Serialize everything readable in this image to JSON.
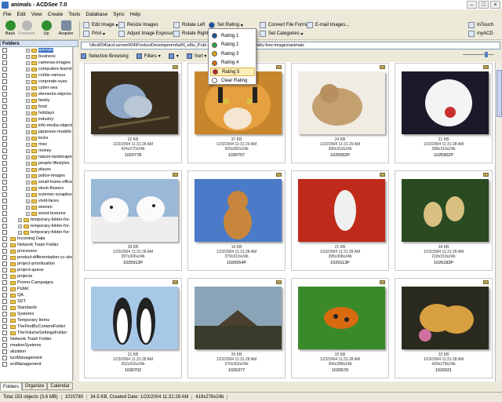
{
  "window": {
    "title": "animals - ACDSee 7.0"
  },
  "menu": [
    "File",
    "Edit",
    "View",
    "Create",
    "Tools",
    "Database",
    "Sync",
    "Help"
  ],
  "toolbar": {
    "back": "Back",
    "forward": "Forward",
    "up": "Up",
    "acquire": "Acquire",
    "edit_image": "Edit Image",
    "print": "Print",
    "resize": "Resize Images",
    "adjust": "Adjust Image Exposure",
    "rotate_left": "Rotate Left",
    "rotate_right": "Rotate Right",
    "set_rating": "Set Rating",
    "convert": "Convert File Format",
    "set_categories": "Set Categories",
    "email": "E-mail Images...",
    "intouch": "InTouch",
    "myacd": "myACD"
  },
  "rating_menu": {
    "items": [
      "Rating 1",
      "Rating 2",
      "Rating 3",
      "Rating 4",
      "Rating 5"
    ],
    "clear": "Clear Rating",
    "selected_index": 4,
    "colors": [
      "#1d4fa0",
      "#2e9e3e",
      "#e0a010",
      "#d86a10",
      "#c02020"
    ]
  },
  "folders": {
    "header": "Folders",
    "items": [
      {
        "label": "animals",
        "depth": 2,
        "exp": "+"
      },
      {
        "label": "business",
        "depth": 2,
        "exp": "+"
      },
      {
        "label": "cameras-images",
        "depth": 2,
        "exp": "+"
      },
      {
        "label": "computers-learning",
        "depth": 2,
        "exp": "+"
      },
      {
        "label": "corbis-various",
        "depth": 2,
        "exp": "+"
      },
      {
        "label": "corporate-eyes",
        "depth": 2,
        "exp": "+"
      },
      {
        "label": "cyber-sea",
        "depth": 2,
        "exp": "+"
      },
      {
        "label": "elements-objects-",
        "depth": 2,
        "exp": "+"
      },
      {
        "label": "family",
        "depth": 2,
        "exp": "+"
      },
      {
        "label": "food",
        "depth": 2,
        "exp": "+"
      },
      {
        "label": "holidays",
        "depth": 2,
        "exp": "+"
      },
      {
        "label": "industry",
        "depth": 2,
        "exp": "+"
      },
      {
        "label": "info-media-objects",
        "depth": 2,
        "exp": "+"
      },
      {
        "label": "japanese-models",
        "depth": 2,
        "exp": "+"
      },
      {
        "label": "locks",
        "depth": 2,
        "exp": "+"
      },
      {
        "label": "misc",
        "depth": 2,
        "exp": "+"
      },
      {
        "label": "money",
        "depth": 2,
        "exp": "+"
      },
      {
        "label": "nature-landscapes",
        "depth": 2,
        "exp": "+"
      },
      {
        "label": "people-lifestyles",
        "depth": 2,
        "exp": "+"
      },
      {
        "label": "places",
        "depth": 2,
        "exp": "+"
      },
      {
        "label": "police-images",
        "depth": 2,
        "exp": "+"
      },
      {
        "label": "small-home-office",
        "depth": 2,
        "exp": "+"
      },
      {
        "label": "stock-flowers",
        "depth": 2,
        "exp": "+"
      },
      {
        "label": "summer-scrapbook",
        "depth": 2,
        "exp": "+"
      },
      {
        "label": "vivid-faces",
        "depth": 2,
        "exp": "+"
      },
      {
        "label": "women",
        "depth": 2,
        "exp": "+"
      },
      {
        "label": "wood-textures",
        "depth": 2,
        "exp": "+"
      },
      {
        "label": "temporary-folder-for-",
        "depth": 1,
        "exp": "+"
      },
      {
        "label": "temporary-folder-for-",
        "depth": 1,
        "exp": "+"
      },
      {
        "label": "temporary-folder-for-",
        "depth": 1,
        "exp": "+"
      },
      {
        "label": "Incoming Data",
        "depth": 0,
        "exp": ""
      },
      {
        "label": "Network Trash Folder",
        "depth": 0,
        "exp": ""
      },
      {
        "label": "processes",
        "depth": 0,
        "exp": ""
      },
      {
        "label": "product-differentiation-cc-sbs",
        "depth": 0,
        "exp": ""
      },
      {
        "label": "project-prioritization",
        "depth": 0,
        "exp": ""
      },
      {
        "label": "project-queue",
        "depth": 0,
        "exp": ""
      },
      {
        "label": "projects",
        "depth": 0,
        "exp": ""
      },
      {
        "label": "Promo-Campaigns",
        "depth": 0,
        "exp": ""
      },
      {
        "label": "Public",
        "depth": 0,
        "exp": ""
      },
      {
        "label": "QA",
        "depth": 0,
        "exp": ""
      },
      {
        "label": "SDT",
        "depth": 0,
        "exp": ""
      },
      {
        "label": "Standards",
        "depth": 0,
        "exp": ""
      },
      {
        "label": "Systems",
        "depth": 0,
        "exp": ""
      },
      {
        "label": "Temporary Items",
        "depth": 0,
        "exp": ""
      },
      {
        "label": "TheFindByContentFolder",
        "depth": 0,
        "exp": ""
      },
      {
        "label": "TheVolumeSettingsFolder",
        "depth": 0,
        "exp": ""
      },
      {
        "label": "Network Trash Folder",
        "depth": -1,
        "exp": ""
      },
      {
        "label": "rmationSystems",
        "depth": -1,
        "exp": ""
      },
      {
        "label": "alization",
        "depth": -1,
        "exp": ""
      },
      {
        "label": "luctManagement",
        "depth": -1,
        "exp": ""
      },
      {
        "label": "ectManagement",
        "depth": -1,
        "exp": ""
      }
    ]
  },
  "pane_tabs": [
    "Folders",
    "Organize",
    "Calendar"
  ],
  "address": "\\\\Acd004\\acd-server004\\ProductDevelopment\\e8\\l_e8iz_Publ                    aphics\\graphics-public\\royalty-free-images\\animals",
  "filterbar": {
    "browse": "Selective Browsing",
    "filters": "Filters",
    "sort": "Sort"
  },
  "images": [
    {
      "size": "32 KB",
      "date": "1/23/2004 11:31:28 AM",
      "dims": "424x270x24b",
      "name": "1020778",
      "kind": "butterfly"
    },
    {
      "size": "37 KB",
      "date": "1/23/2004 11:31:29 AM",
      "dims": "429x282x24b",
      "name": "1030707",
      "kind": "tiger"
    },
    {
      "size": "24 KB",
      "date": "1/23/2004 11:31:29 AM",
      "dims": "390x310x24b",
      "name": "1025092P",
      "kind": "dog"
    },
    {
      "size": "21 KB",
      "date": "1/23/2004 11:31:28 AM",
      "dims": "288x310x24b",
      "name": "1025902P",
      "kind": "cockatoo"
    },
    {
      "size": "39 KB",
      "date": "1/23/2004 11:31:28 AM",
      "dims": "397x306x24b",
      "name": "1025913P",
      "kind": "dalmatians"
    },
    {
      "size": "14 KB",
      "date": "1/23/2004 11:31:28 AM",
      "dims": "379x310x24b",
      "name": "1026054P",
      "kind": "puppy"
    },
    {
      "size": "21 KB",
      "date": "1/23/2004 11:31:28 AM",
      "dims": "395x308x24b",
      "name": "1026113P",
      "kind": "parrot"
    },
    {
      "size": "34 KB",
      "date": "1/23/2004 11:31:28 AM",
      "dims": "218x310x24b",
      "name": "1026183P",
      "kind": "ducks"
    },
    {
      "size": "21 KB",
      "date": "1/23/2004 11:31:28 AM",
      "dims": "252x316x24b",
      "name": "1030702",
      "kind": "penguins"
    },
    {
      "size": "26 KB",
      "date": "1/23/2004 11:31:28 AM",
      "dims": "270x303x24b",
      "name": "1026377",
      "kind": "storks"
    },
    {
      "size": "32 KB",
      "date": "1/23/2004 11:31:28 AM",
      "dims": "394x288x24b",
      "name": "1026570",
      "kind": "ladybug"
    },
    {
      "size": "32 KB",
      "date": "1/23/2004 11:31:28 AM",
      "dims": "429x278x24b",
      "name": "1026921",
      "kind": "butterfly2"
    }
  ],
  "status": {
    "total": "Total 153 objects  (3.6 MB)",
    "file": "1020780",
    "info": "34.5 KB, Created Date: 1/23/2004 11:31:28 AM",
    "dims": "419x278x24b"
  }
}
